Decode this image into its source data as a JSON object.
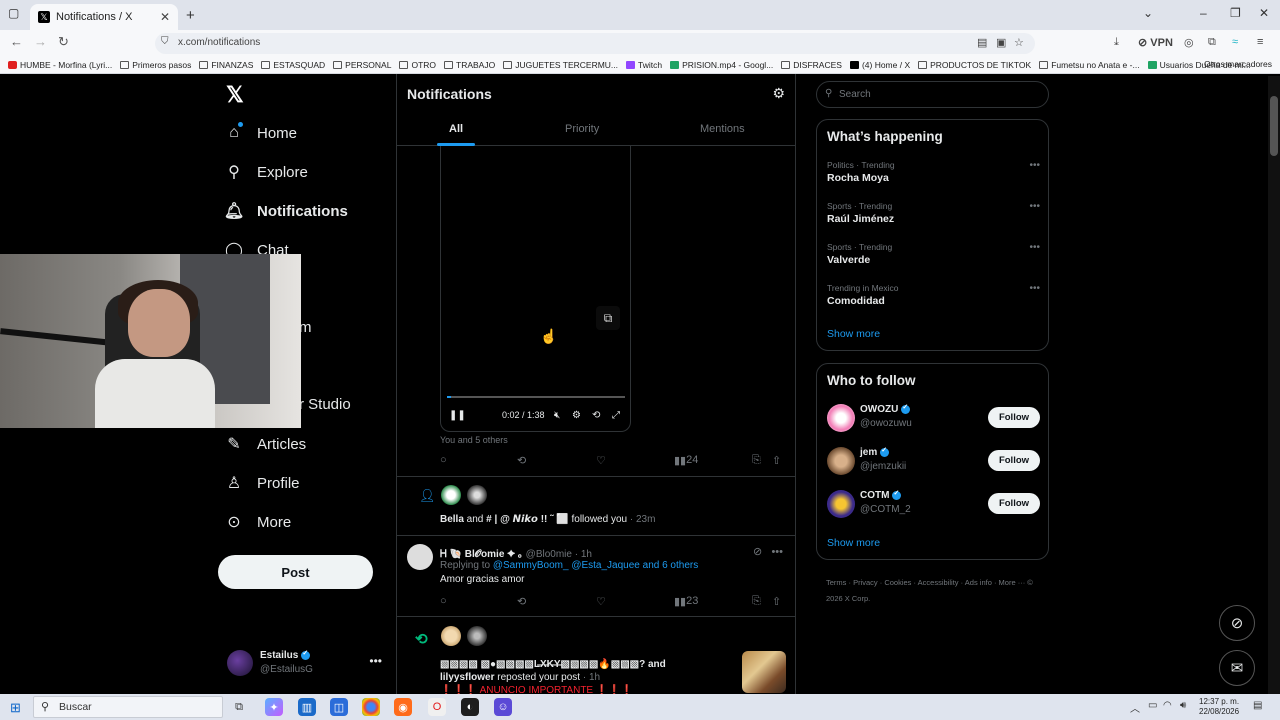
{
  "browser": {
    "tab_title": "Notifications / X",
    "url": "x.com/notifications",
    "vpn_label": "VPN",
    "bookmarks": [
      {
        "label": "HUMBE - Morfina (Lyri...",
        "icon": "red"
      },
      {
        "label": "Primeros pasos",
        "icon": "folder"
      },
      {
        "label": "FINANZAS",
        "icon": "folder"
      },
      {
        "label": "ESTASQUAD",
        "icon": "folder"
      },
      {
        "label": "PERSONAL",
        "icon": "folder"
      },
      {
        "label": "OTRO",
        "icon": "folder"
      },
      {
        "label": "TRABAJO",
        "icon": "folder"
      },
      {
        "label": "JUGUETES TERCERMU...",
        "icon": "folder"
      },
      {
        "label": "Twitch",
        "icon": "purp"
      },
      {
        "label": "PRISION.mp4 - Googl...",
        "icon": "gd"
      },
      {
        "label": "DISFRACES",
        "icon": "folder"
      },
      {
        "label": "(4) Home / X",
        "icon": "xx"
      },
      {
        "label": "PRODUCTOS DE TIKTOK",
        "icon": "folder"
      },
      {
        "label": "Fumetsu no Anata e -...",
        "icon": "folder"
      },
      {
        "label": "Usuarios Dueña de mi...",
        "icon": "gd"
      }
    ],
    "other_bookmarks": "Otros marcadores"
  },
  "nav": {
    "home": "Home",
    "explore": "Explore",
    "notifications": "Notifications",
    "chat": "Chat",
    "premium_partial": "m",
    "studio_partial": "r Studio",
    "articles": "Articles",
    "profile": "Profile",
    "more": "More",
    "post": "Post"
  },
  "account": {
    "name": "Estailus",
    "handle": "@EstailusG"
  },
  "notifications": {
    "title": "Notifications",
    "tabs": [
      "All",
      "Priority",
      "Mentions"
    ],
    "video": {
      "time": "0:02 / 1:38",
      "progress": 0.02
    },
    "liked_by": "You and 5 others",
    "post_actions": {
      "views": "24"
    },
    "follow": {
      "text_bold": "Bella",
      "text_mid": " and ",
      "text_bold2": "# | @ 𝙉𝙞𝙠𝙤 !! ˜ ⬜",
      "text_end": " followed you",
      "time": " · 23m"
    },
    "reply": {
      "name": "Ꮋ 🐚 Bl𝓞omie ✦ ｡",
      "handle": " @Blo0mie · 1h",
      "replying_prefix": "Replying to ",
      "replying_to": "@SammyBoom_ @Esta_Jaquee and 6 others",
      "text": "Amor gracias amor",
      "views": "23"
    },
    "repost": {
      "line1": "▧▧▧▧ ▧●▧▧▧▧L̶X̶K̶Y̶▧▧▧▧🔥▧▧▧? and",
      "user": "lilyysflower",
      "line2": " reposted your post",
      "time": " · 1h",
      "sub": "❗❗❗ ANUNCIO IMPORTANTE ❗❗❗"
    }
  },
  "right": {
    "search_placeholder": "Search",
    "happening_title": "What’s happening",
    "trends": [
      {
        "category": "Politics · Trending",
        "name": "Rocha Moya"
      },
      {
        "category": "Sports · Trending",
        "name": "Raúl Jiménez"
      },
      {
        "category": "Sports · Trending",
        "name": "Valverde"
      },
      {
        "category": "Trending in Mexico",
        "name": "Comodidad"
      }
    ],
    "show_more": "Show more",
    "wtf_title": "Who to follow",
    "follow_suggestions": [
      {
        "name": "OWOZU",
        "handle": "@owozuwu",
        "button": "Follow",
        "color": "#f3e6ef"
      },
      {
        "name": "jem",
        "handle": "@jemzukii",
        "button": "Follow",
        "color": "#7a5a3a"
      },
      {
        "name": "COTM",
        "handle": "@COTM_2",
        "button": "Follow",
        "color": "#3b2a8a"
      }
    ],
    "footer": "Terms ·   Privacy ·   Cookies ·   Accessibility ·   Ads info ·   More ···   © 2026 X Corp."
  },
  "taskbar": {
    "search": "Buscar",
    "time": "12:37 p. m.",
    "date": "22/08/2026"
  }
}
